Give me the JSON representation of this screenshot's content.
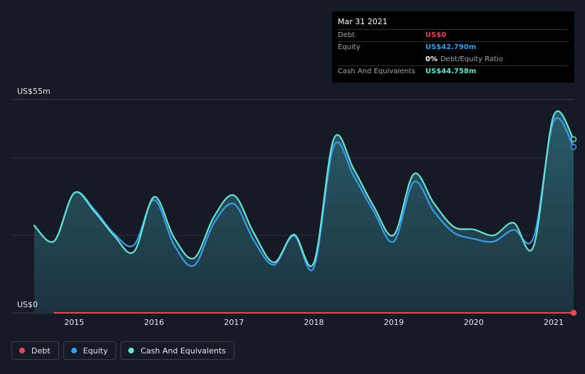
{
  "tooltip": {
    "date": "Mar 31 2021",
    "rows": [
      {
        "label": "Debt",
        "value": "US$0",
        "color": "#e64a53"
      },
      {
        "label": "Equity",
        "value": "US$42.790m",
        "color": "#3b9be6"
      },
      {
        "ratio_pct": "0%",
        "ratio_text": "Debt/Equity Ratio"
      },
      {
        "label": "Cash And Equivalents",
        "value": "US$44.758m",
        "color": "#6de0d4"
      }
    ]
  },
  "legend": [
    {
      "label": "Debt",
      "color": "#e64a53"
    },
    {
      "label": "Equity",
      "color": "#3b9be6"
    },
    {
      "label": "Cash And Equivalents",
      "color": "#6de0d4"
    }
  ],
  "colors": {
    "debt": "#e64a53",
    "equity": "#3b9be6",
    "cash": "#6de0d4",
    "grid": "#2a303b"
  },
  "chart_data": {
    "type": "line",
    "ylabel_top": "US$55m",
    "ylabel_bottom": "US$0",
    "ylim": [
      0,
      55
    ],
    "xlim": [
      2014.5,
      2021.25
    ],
    "xticks": [
      "2015",
      "2016",
      "2017",
      "2018",
      "2019",
      "2020",
      "2021"
    ],
    "series": [
      {
        "name": "Debt",
        "key": "debt",
        "x": [
          2014.75,
          2021.25
        ],
        "y": [
          0,
          0
        ]
      },
      {
        "name": "Equity",
        "key": "equity",
        "x": [
          2014.5,
          2014.75,
          2015.0,
          2015.25,
          2015.5,
          2015.75,
          2016.0,
          2016.25,
          2016.5,
          2016.75,
          2017.0,
          2017.25,
          2017.5,
          2017.75,
          2018.0,
          2018.25,
          2018.5,
          2018.75,
          2019.0,
          2019.25,
          2019.5,
          2019.75,
          2020.0,
          2020.25,
          2020.5,
          2020.75,
          2021.0,
          2021.25
        ],
        "y": [
          22.5,
          18.5,
          30.9,
          26.7,
          20.4,
          17.5,
          29.1,
          17.5,
          12.2,
          23.2,
          28.1,
          18.6,
          12.4,
          19.9,
          11.7,
          43.0,
          35.2,
          26.1,
          18.4,
          33.7,
          26.2,
          20.7,
          19.1,
          18.4,
          21.4,
          19.5,
          49.3,
          42.79
        ]
      },
      {
        "name": "Cash And Equivalents",
        "key": "cash",
        "x": [
          2014.5,
          2014.75,
          2015.0,
          2015.25,
          2015.5,
          2015.75,
          2016.0,
          2016.25,
          2016.5,
          2016.75,
          2017.0,
          2017.25,
          2017.5,
          2017.75,
          2018.0,
          2018.25,
          2018.5,
          2018.75,
          2019.0,
          2019.25,
          2019.5,
          2019.75,
          2020.0,
          2020.25,
          2020.5,
          2020.75,
          2021.0,
          2021.25
        ],
        "y": [
          22.5,
          18.5,
          30.9,
          26.2,
          19.9,
          15.8,
          29.9,
          19.4,
          14.1,
          24.8,
          30.3,
          20.5,
          13.0,
          20.2,
          12.9,
          44.9,
          37.0,
          27.4,
          20.1,
          35.8,
          28.3,
          22.2,
          21.5,
          20.0,
          23.2,
          17.2,
          50.8,
          44.758
        ]
      }
    ]
  }
}
